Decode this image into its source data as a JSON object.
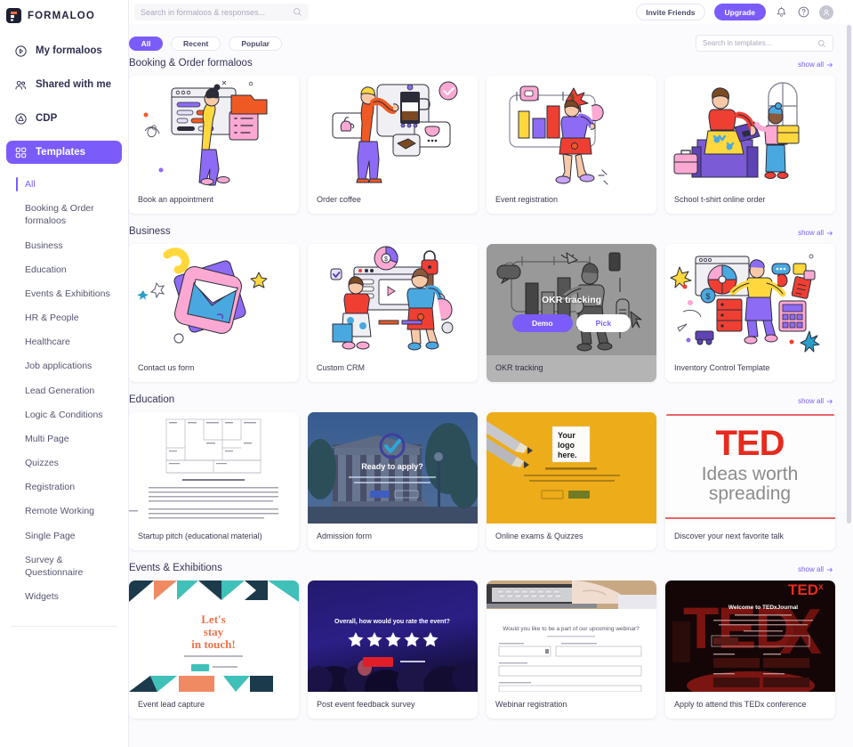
{
  "brand": {
    "name": "FORMALOO",
    "accent": "#7b5cfa",
    "logo_icon": "formaloo-logo-icon"
  },
  "topbar": {
    "search_placeholder": "Search in formaloos & responses...",
    "search_value": "",
    "search_icon": "search-icon",
    "invite_label": "Invite Friends",
    "upgrade_label": "Upgrade",
    "notification_icon": "bell-icon",
    "help_icon": "help-circle-icon",
    "avatar_icon": "user-avatar-icon"
  },
  "sidebar": {
    "items": [
      {
        "label": "My formaloos",
        "icon": "play-circle-icon",
        "active": false
      },
      {
        "label": "Shared with me",
        "icon": "users-icon",
        "active": false
      },
      {
        "label": "CDP",
        "icon": "database-circle-icon",
        "active": false
      },
      {
        "label": "Templates",
        "icon": "grid-squares-icon",
        "active": true
      }
    ],
    "categories": [
      {
        "label": "All",
        "active": true
      },
      {
        "label": "Booking & Order formaloos",
        "active": false
      },
      {
        "label": "Business",
        "active": false
      },
      {
        "label": "Education",
        "active": false
      },
      {
        "label": "Events & Exhibitions",
        "active": false
      },
      {
        "label": "HR & People",
        "active": false
      },
      {
        "label": "Healthcare",
        "active": false
      },
      {
        "label": "Job applications",
        "active": false
      },
      {
        "label": "Lead Generation",
        "active": false
      },
      {
        "label": "Logic & Conditions",
        "active": false
      },
      {
        "label": "Multi Page",
        "active": false
      },
      {
        "label": "Quizzes",
        "active": false
      },
      {
        "label": "Registration",
        "active": false
      },
      {
        "label": "Remote Working",
        "active": false
      },
      {
        "label": "Single Page",
        "active": false
      },
      {
        "label": "Survey & Questionnaire",
        "active": false
      },
      {
        "label": "Widgets",
        "active": false
      }
    ]
  },
  "filters": {
    "chips": [
      {
        "label": "All",
        "active": true
      },
      {
        "label": "Recent",
        "active": false
      },
      {
        "label": "Popular",
        "active": false
      }
    ],
    "search_placeholder": "Search in templates...",
    "search_value": "",
    "search_icon": "search-icon"
  },
  "show_all_label": "show all",
  "hover_overlay": {
    "title": "OKR tracking",
    "demo_label": "Demo",
    "pick_label": "Pick"
  },
  "sections": [
    {
      "title": "Booking & Order formaloos",
      "cards": [
        {
          "label": "Book an appointment",
          "thumb": "illustration-appointment",
          "hovered": false
        },
        {
          "label": "Order coffee",
          "thumb": "illustration-coffee",
          "hovered": false
        },
        {
          "label": "Event registration",
          "thumb": "illustration-event",
          "hovered": false
        },
        {
          "label": "School t-shirt online order",
          "thumb": "illustration-school",
          "hovered": false
        }
      ]
    },
    {
      "title": "Business",
      "cards": [
        {
          "label": "Contact us form",
          "thumb": "illustration-envelope",
          "hovered": false
        },
        {
          "label": "Custom CRM",
          "thumb": "illustration-crm",
          "hovered": false
        },
        {
          "label": "OKR tracking",
          "thumb": "illustration-okr",
          "hovered": true
        },
        {
          "label": "Inventory Control Template",
          "thumb": "illustration-inventory",
          "hovered": false
        }
      ]
    },
    {
      "title": "Education",
      "cards": [
        {
          "label": "Startup pitch (educational material)",
          "thumb": "photo-lean-canvas",
          "hovered": false
        },
        {
          "label": "Admission form",
          "thumb": "photo-campus-ready-to-apply",
          "hovered": false
        },
        {
          "label": "Online exams & Quizzes",
          "thumb": "photo-yellow-pencils",
          "hovered": false
        },
        {
          "label": "Discover your next favorite talk",
          "thumb": "photo-ted-ideas-worth-spreading",
          "hovered": false
        }
      ]
    },
    {
      "title": "Events & Exhibitions",
      "cards": [
        {
          "label": "Event lead capture",
          "thumb": "photo-lets-stay-in-touch",
          "hovered": false
        },
        {
          "label": "Post event feedback survey",
          "thumb": "photo-concert-rating",
          "hovered": false
        },
        {
          "label": "Webinar registration",
          "thumb": "photo-laptop-webinar",
          "hovered": false
        },
        {
          "label": "Apply to attend this TEDx conference",
          "thumb": "photo-tedx-red",
          "hovered": false
        }
      ]
    }
  ],
  "thumb_text": {
    "ready_to_apply": "Ready to apply?",
    "your_logo_here": "Your logo here.",
    "ted_logo": "TED",
    "ted_tagline_1": "Ideas worth",
    "ted_tagline_2": "spreading",
    "lets_stay_1": "Let's",
    "lets_stay_2": "stay",
    "lets_stay_3": "in touch!",
    "rate_event": "Overall, how would you rate the event?",
    "webinar_q": "Would you like to be a part of our upcoming webinar?",
    "tedx_welcome": "Welcome to TEDxJournal",
    "tedx_logo": "TED",
    "lean_canvas_caption": "Startup Pitch Lean Canvas Style"
  }
}
